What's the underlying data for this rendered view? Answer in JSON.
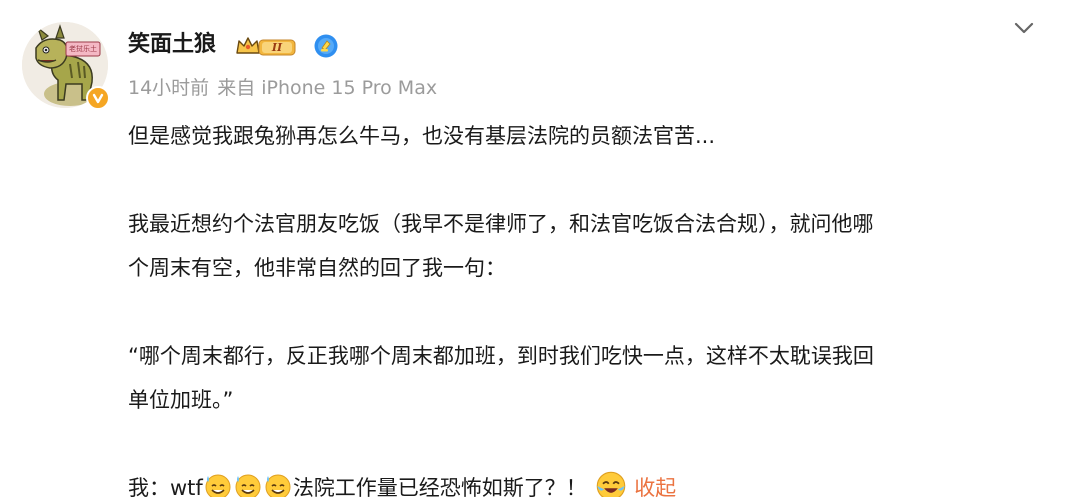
{
  "post": {
    "username": "笑面土狼",
    "timestamp": "14小时前",
    "source": "来自 iPhone 15 Pro Max",
    "lines": [
      "但是感觉我跟兔狲再怎么牛马，也没有基层法院的员额法官苦...",
      "我最近想约个法官朋友吃饭（我早不是律师了，和法官吃饭合法合规），就问他哪",
      "个周末有空，他非常自然的回了我一句：",
      "“哪个周末都行，反正我哪个周末都加班，到时我们吃快一点，这样不太耽误我回",
      "单位加班。”"
    ],
    "last_line_prefix": "我：wtf",
    "last_line_suffix": "法院工作量已经恐怖如斯了？！",
    "collapse_label": "收起",
    "badges": {
      "vip_level": "II",
      "avatar_sign": "老挝乐土"
    },
    "icons": [
      "avatar-image",
      "verified-orange-icon",
      "vip-crown-badge-icon",
      "blue-v-verified-icon",
      "chevron-down-icon",
      "sweat-smile-emoji",
      "cry-laugh-emoji"
    ],
    "colors": {
      "link": "#eb7340",
      "meta": "#9b9b9b",
      "text": "#1a1a1a",
      "verified": "#f5a623",
      "vip_gold": "#e8a93a"
    }
  }
}
